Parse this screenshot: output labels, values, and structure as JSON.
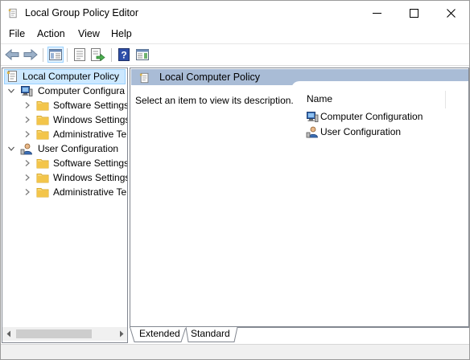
{
  "window": {
    "title": "Local Group Policy Editor",
    "icons": {
      "app": "policy-document-icon",
      "minimize": "minimize-icon",
      "maximize": "maximize-icon",
      "close": "close-icon"
    }
  },
  "menu": {
    "items": [
      {
        "label": "File"
      },
      {
        "label": "Action"
      },
      {
        "label": "View"
      },
      {
        "label": "Help"
      }
    ]
  },
  "toolbar": {
    "buttons": [
      {
        "name": "back-icon"
      },
      {
        "name": "forward-icon"
      },
      {
        "name": "show-hide-console-tree-icon"
      },
      {
        "name": "properties-icon"
      },
      {
        "name": "export-list-icon"
      },
      {
        "name": "help-icon"
      },
      {
        "name": "show-hide-action-pane-icon"
      }
    ]
  },
  "tree": {
    "root": {
      "label": "Local Computer Policy",
      "icon": "policy-document-icon",
      "selected": true
    },
    "nodes": [
      {
        "label": "Computer Configura",
        "icon": "computer-icon",
        "expanded": true,
        "children": [
          {
            "label": "Software Settings",
            "icon": "folder-icon"
          },
          {
            "label": "Windows Settings",
            "icon": "folder-icon"
          },
          {
            "label": "Administrative Te",
            "icon": "folder-icon"
          }
        ]
      },
      {
        "label": "User Configuration",
        "icon": "user-icon",
        "expanded": true,
        "children": [
          {
            "label": "Software Settings",
            "icon": "folder-icon"
          },
          {
            "label": "Windows Settings",
            "icon": "folder-icon"
          },
          {
            "label": "Administrative Te",
            "icon": "folder-icon"
          }
        ]
      }
    ]
  },
  "details": {
    "header": "Local Computer Policy",
    "description": "Select an item to view its description.",
    "column_name": "Name",
    "items": [
      {
        "label": "Computer Configuration",
        "icon": "computer-icon"
      },
      {
        "label": "User Configuration",
        "icon": "user-icon"
      }
    ]
  },
  "tabs": {
    "items": [
      {
        "label": "Extended",
        "active": true
      },
      {
        "label": "Standard",
        "active": false
      }
    ]
  },
  "colors": {
    "selection_bg": "#cce8ff",
    "header_bg": "#a9bcd6",
    "folder": "#f3c54a"
  }
}
